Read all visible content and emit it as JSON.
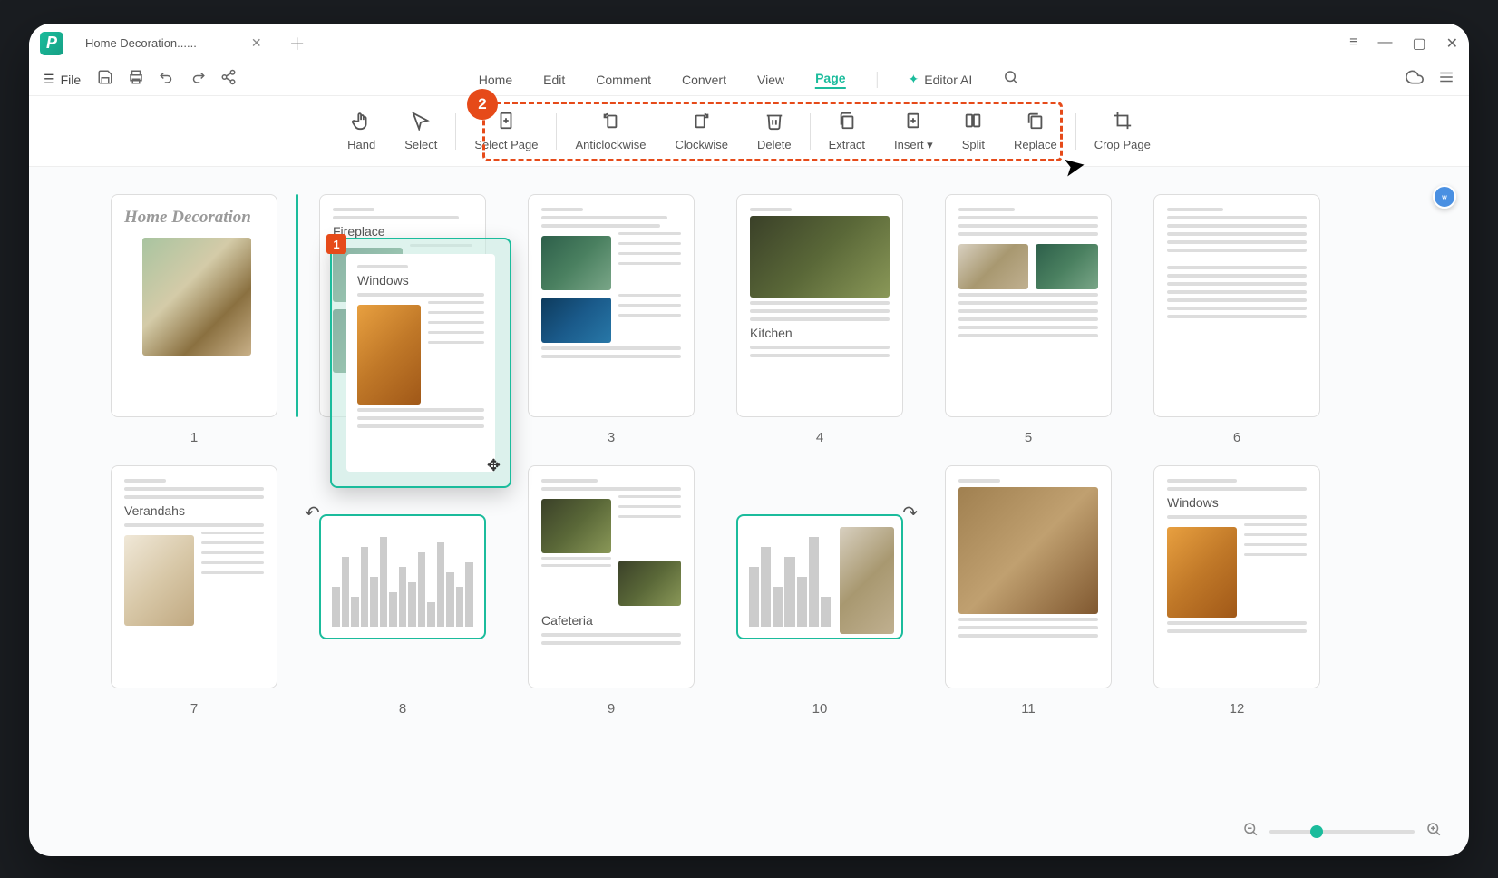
{
  "titlebar": {
    "tab_title": "Home Decoration......"
  },
  "file_menu": {
    "label": "File"
  },
  "menu_tabs": {
    "home": "Home",
    "edit": "Edit",
    "comment": "Comment",
    "convert": "Convert",
    "view": "View",
    "page": "Page",
    "editor_ai": "Editor AI"
  },
  "toolbar": {
    "hand": "Hand",
    "select": "Select",
    "select_page": "Select Page",
    "anticlockwise": "Anticlockwise",
    "clockwise": "Clockwise",
    "delete": "Delete",
    "extract": "Extract",
    "insert": "Insert",
    "split": "Split",
    "replace": "Replace",
    "crop_page": "Crop Page"
  },
  "callout": {
    "number": "2"
  },
  "drag": {
    "badge": "1",
    "title": "Windows"
  },
  "pages": {
    "p1_title": "Home Decoration",
    "p2_title": "Fireplace",
    "p4_title": "Kitchen",
    "p7_title": "Verandahs",
    "p9_title": "Cafeteria",
    "p12_title": "Windows",
    "num1": "1",
    "num3": "3",
    "num4": "4",
    "num5": "5",
    "num6": "6",
    "num7": "7",
    "num8": "8",
    "num9": "9",
    "num10": "10",
    "num11": "11",
    "num12": "12"
  }
}
